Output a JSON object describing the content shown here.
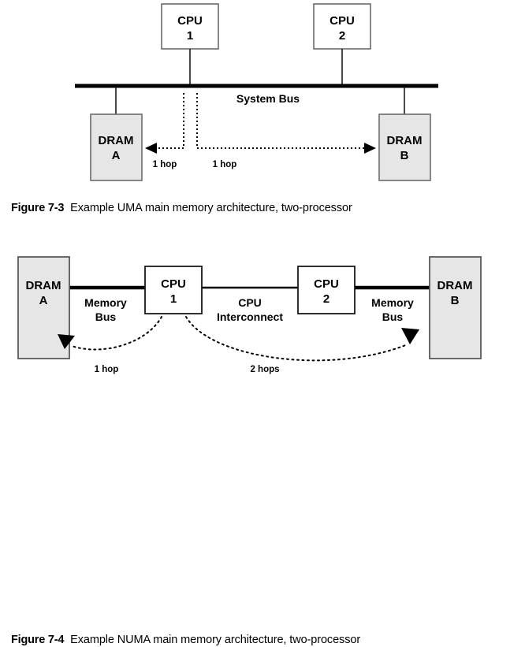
{
  "figures": [
    {
      "id": "uma",
      "caption_label": "Figure 7-3",
      "caption_text": "Example UMA main memory architecture, two-processor",
      "nodes": {
        "cpu1_line1": "CPU",
        "cpu1_line2": "1",
        "cpu2_line1": "CPU",
        "cpu2_line2": "2",
        "dram_a_line1": "DRAM",
        "dram_a_line2": "A",
        "dram_b_line1": "DRAM",
        "dram_b_line2": "B"
      },
      "bus_label": "System Bus",
      "hop_left": "1 hop",
      "hop_right": "1 hop"
    },
    {
      "id": "numa",
      "caption_label": "Figure 7-4",
      "caption_text": "Example NUMA main memory architecture, two-processor",
      "nodes": {
        "dram_a_line1": "DRAM",
        "dram_a_line2": "A",
        "cpu1_line1": "CPU",
        "cpu1_line2": "1",
        "cpu2_line1": "CPU",
        "cpu2_line2": "2",
        "dram_b_line1": "DRAM",
        "dram_b_line2": "B"
      },
      "link_left_line1": "Memory",
      "link_left_line2": "Bus",
      "link_mid_line1": "CPU",
      "link_mid_line2": "Interconnect",
      "link_right_line1": "Memory",
      "link_right_line2": "Bus",
      "hop_left": "1 hop",
      "hop_right": "2 hops"
    }
  ],
  "colors": {
    "dram_fill": "#e6e6e6",
    "cpu_fill": "#ffffff",
    "line": "#000000",
    "box_stroke": "#6b6b6b",
    "page_background": "#ffffff"
  }
}
